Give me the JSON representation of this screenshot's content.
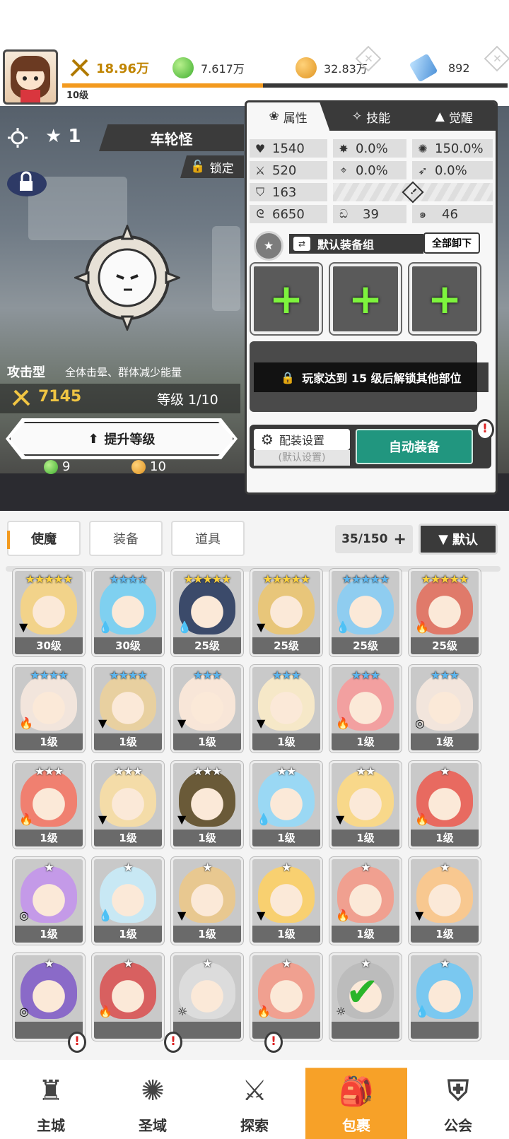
{
  "topbar": {
    "power": "18.96万",
    "green_gem": "7.617万",
    "gold": "32.83万",
    "crystal": "892",
    "player_level": "10级",
    "xp_progress": 0.45
  },
  "hero": {
    "star": "1",
    "name": "车轮怪",
    "lock_label": "锁定",
    "type": "攻击型",
    "skill": "全体击晕、群体减少能量",
    "power": "7145",
    "level": "等级 1/10",
    "upgrade_label": "提升等级",
    "cost_green": "9",
    "cost_gold": "10"
  },
  "tabs": [
    {
      "label": "属性"
    },
    {
      "label": "技能"
    },
    {
      "label": "觉醒"
    }
  ],
  "stats": {
    "hp": "1540",
    "atk": "520",
    "def": "163",
    "speed": "6650",
    "crit": "0.0%",
    "hit": "0.0%",
    "crit_dmg": "150.0%",
    "dodge": "0.0%",
    "stat_a": "39",
    "stat_b": "46"
  },
  "equip": {
    "group_label": "默认装备组",
    "unequip_all": "全部卸下",
    "locked_msg": "玩家达到 15 级后解锁其他部位",
    "config_label": "配装设置",
    "config_sub": "(默认设置)",
    "auto_label": "自动装备"
  },
  "inventory": {
    "tabs": [
      "使魔",
      "装备",
      "道具"
    ],
    "capacity": "35/150",
    "sort_label": "默认",
    "cards": [
      {
        "stars": "★★★★★",
        "level": "30级"
      },
      {
        "stars": "★★★★",
        "level": "30级"
      },
      {
        "stars": "★★★★★",
        "level": "25级"
      },
      {
        "stars": "★★★★★",
        "level": "25级"
      },
      {
        "stars": "★★★★★",
        "level": "25级"
      },
      {
        "stars": "★★★★★",
        "level": "25级"
      },
      {
        "stars": "★★★★",
        "level": "1级"
      },
      {
        "stars": "★★★★",
        "level": "1级"
      },
      {
        "stars": "★★★",
        "level": "1级"
      },
      {
        "stars": "★★★",
        "level": "1级"
      },
      {
        "stars": "★★★",
        "level": "1级"
      },
      {
        "stars": "★★★",
        "level": "1级"
      },
      {
        "stars": "★★★",
        "level": "1级"
      },
      {
        "stars": "★★★",
        "level": "1级"
      },
      {
        "stars": "★★★",
        "level": "1级"
      },
      {
        "stars": "★★",
        "level": "1级"
      },
      {
        "stars": "★★",
        "level": "1级"
      },
      {
        "stars": "★",
        "level": "1级"
      },
      {
        "stars": "★",
        "level": "1级"
      },
      {
        "stars": "★",
        "level": "1级"
      },
      {
        "stars": "★",
        "level": "1级"
      },
      {
        "stars": "★",
        "level": "1级"
      },
      {
        "stars": "★",
        "level": "1级"
      },
      {
        "stars": "★",
        "level": "1级"
      },
      {
        "stars": "★",
        "level": ""
      },
      {
        "stars": "★",
        "level": ""
      },
      {
        "stars": "★",
        "level": ""
      },
      {
        "stars": "★",
        "level": ""
      },
      {
        "stars": "★",
        "level": ""
      },
      {
        "stars": "★",
        "level": ""
      }
    ]
  },
  "nav": [
    {
      "label": "主城"
    },
    {
      "label": "圣域"
    },
    {
      "label": "探索"
    },
    {
      "label": "包裹"
    },
    {
      "label": "公会"
    }
  ],
  "colors": {
    "accent": "#f39a1e",
    "auto_equip": "#21967f",
    "plus": "#7df43d"
  }
}
